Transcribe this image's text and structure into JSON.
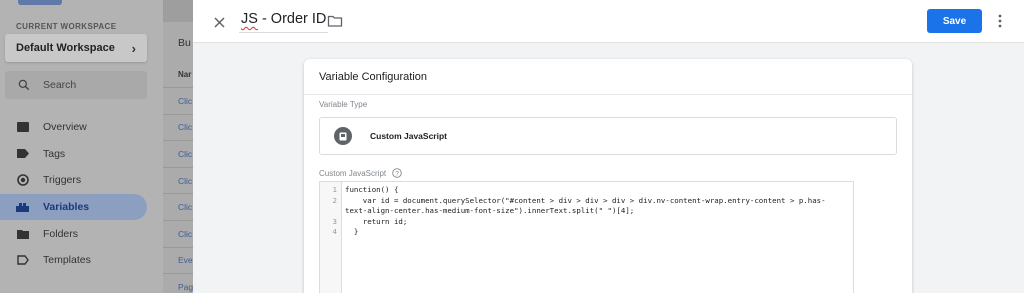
{
  "background": {
    "workspace_label": "CURRENT WORKSPACE",
    "workspace_name": "Default Workspace",
    "search_placeholder": "Search",
    "nav": [
      {
        "label": "Overview",
        "icon": "overview-icon"
      },
      {
        "label": "Tags",
        "icon": "tag-icon"
      },
      {
        "label": "Triggers",
        "icon": "trigger-icon"
      },
      {
        "label": "Variables",
        "icon": "variables-icon",
        "active": true
      },
      {
        "label": "Folders",
        "icon": "folder-icon"
      },
      {
        "label": "Templates",
        "icon": "template-icon"
      }
    ],
    "list_title": "Bu",
    "list_header": "Nar",
    "list_rows": [
      "Clic",
      "Clic",
      "Clic",
      "Clic",
      "Clic",
      "Clic",
      "Eve",
      "Pag"
    ]
  },
  "editor_panel": {
    "title_prefix": "JS",
    "title_rest": " - Order ID",
    "save_label": "Save",
    "card_title": "Variable Configuration",
    "variable_type_label": "Variable Type",
    "variable_type_name": "Custom JavaScript",
    "custom_js_label": "Custom JavaScript",
    "line_numbers": [
      "1",
      "2",
      "",
      "3",
      "4"
    ],
    "code_lines": [
      "function() {",
      "    var id = document.querySelector(\"#content > div > div > div > div.nv-content-wrap.entry-content > p.has-",
      "text-align-center.has-medium-font-size\").innerText.split(\" \")[4];",
      "    return id;",
      "  }"
    ]
  },
  "colors": {
    "accent": "#1a73e8",
    "active_nav": "#8d9fc0"
  }
}
